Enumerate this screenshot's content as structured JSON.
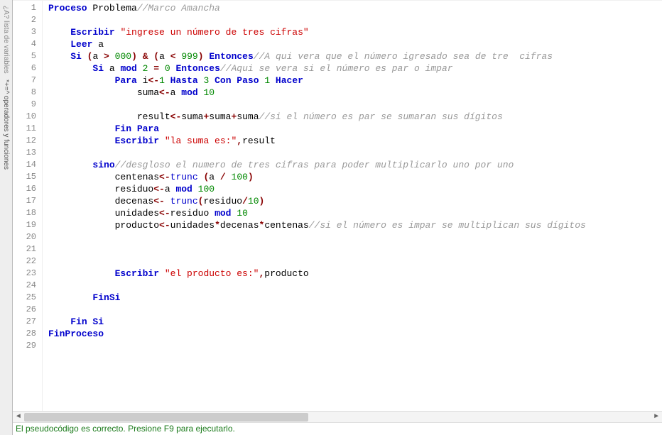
{
  "sidebar": {
    "tab1_icon": "¿A?",
    "tab1_label": " lista de variables",
    "tab2_icon": "*+=^",
    "tab2_label": " operadores y funciones"
  },
  "lines": [
    {
      "n": "1",
      "indent": 0,
      "tokens": [
        [
          "kw",
          "Proceso"
        ],
        [
          "ident",
          " Problema"
        ],
        [
          "com",
          "//Marco Amancha"
        ]
      ]
    },
    {
      "n": "2",
      "indent": 1,
      "tokens": []
    },
    {
      "n": "3",
      "indent": 1,
      "tokens": [
        [
          "kw",
          "Escribir "
        ],
        [
          "str",
          "\"ingrese un número de tres cifras\""
        ]
      ]
    },
    {
      "n": "4",
      "indent": 1,
      "tokens": [
        [
          "kw",
          "Leer"
        ],
        [
          "ident",
          " a"
        ]
      ]
    },
    {
      "n": "5",
      "indent": 1,
      "tokens": [
        [
          "kw",
          "Si "
        ],
        [
          "op",
          "("
        ],
        [
          "ident",
          "a "
        ],
        [
          "op",
          ">"
        ],
        [
          "num",
          " 000"
        ],
        [
          "op",
          ")"
        ],
        [
          "op",
          " & "
        ],
        [
          "op",
          "("
        ],
        [
          "ident",
          "a "
        ],
        [
          "op",
          "<"
        ],
        [
          "num",
          " 999"
        ],
        [
          "op",
          ")"
        ],
        [
          "kw",
          " Entonces"
        ],
        [
          "com",
          "//A qui vera que el número igresado sea de tre  cifras"
        ]
      ]
    },
    {
      "n": "6",
      "indent": 2,
      "tokens": [
        [
          "kw",
          "Si"
        ],
        [
          "ident",
          " a "
        ],
        [
          "kw",
          "mod "
        ],
        [
          "num",
          "2"
        ],
        [
          "op",
          " = "
        ],
        [
          "num",
          "0"
        ],
        [
          "kw",
          " Entonces"
        ],
        [
          "com",
          "//Aqui se vera si el número es par o impar"
        ]
      ]
    },
    {
      "n": "7",
      "indent": 3,
      "tokens": [
        [
          "kw",
          "Para"
        ],
        [
          "ident",
          " i"
        ],
        [
          "op",
          "<-"
        ],
        [
          "num",
          "1"
        ],
        [
          "kw",
          " Hasta "
        ],
        [
          "num",
          "3"
        ],
        [
          "kw",
          " Con Paso "
        ],
        [
          "num",
          "1"
        ],
        [
          "kw",
          " Hacer"
        ]
      ]
    },
    {
      "n": "8",
      "indent": 4,
      "tokens": [
        [
          "ident",
          "suma"
        ],
        [
          "op",
          "<-"
        ],
        [
          "ident",
          "a "
        ],
        [
          "kw",
          "mod "
        ],
        [
          "num",
          "10"
        ]
      ]
    },
    {
      "n": "9",
      "indent": 4,
      "tokens": []
    },
    {
      "n": "10",
      "indent": 4,
      "tokens": [
        [
          "ident",
          "result"
        ],
        [
          "op",
          "<-"
        ],
        [
          "ident",
          "suma"
        ],
        [
          "op",
          "+"
        ],
        [
          "ident",
          "suma"
        ],
        [
          "op",
          "+"
        ],
        [
          "ident",
          "suma"
        ],
        [
          "com",
          "//si el número es par se sumaran sus dígitos"
        ]
      ]
    },
    {
      "n": "11",
      "indent": 3,
      "tokens": [
        [
          "kw",
          "Fin Para"
        ]
      ]
    },
    {
      "n": "12",
      "indent": 3,
      "tokens": [
        [
          "kw",
          "Escribir "
        ],
        [
          "str",
          "\"la suma es:\""
        ],
        [
          "op",
          ","
        ],
        [
          "ident",
          "result"
        ]
      ]
    },
    {
      "n": "13",
      "indent": 3,
      "tokens": []
    },
    {
      "n": "14",
      "indent": 2,
      "tokens": [
        [
          "kw",
          "sino"
        ],
        [
          "com",
          "//desgloso el numero de tres cifras para poder multiplicarlo uno por uno"
        ]
      ]
    },
    {
      "n": "15",
      "indent": 3,
      "tokens": [
        [
          "ident",
          "centenas"
        ],
        [
          "op",
          "<-"
        ],
        [
          "func",
          "trunc"
        ],
        [
          "ident",
          " "
        ],
        [
          "op",
          "("
        ],
        [
          "ident",
          "a "
        ],
        [
          "op",
          "/"
        ],
        [
          "num",
          " 100"
        ],
        [
          "op",
          ")"
        ]
      ]
    },
    {
      "n": "16",
      "indent": 3,
      "tokens": [
        [
          "ident",
          "residuo"
        ],
        [
          "op",
          "<-"
        ],
        [
          "ident",
          "a "
        ],
        [
          "kw",
          "mod "
        ],
        [
          "num",
          "100"
        ]
      ]
    },
    {
      "n": "17",
      "indent": 3,
      "tokens": [
        [
          "ident",
          "decenas"
        ],
        [
          "op",
          "<- "
        ],
        [
          "func",
          "trunc"
        ],
        [
          "op",
          "("
        ],
        [
          "ident",
          "residuo"
        ],
        [
          "op",
          "/"
        ],
        [
          "num",
          "10"
        ],
        [
          "op",
          ")"
        ]
      ]
    },
    {
      "n": "18",
      "indent": 3,
      "tokens": [
        [
          "ident",
          "unidades"
        ],
        [
          "op",
          "<-"
        ],
        [
          "ident",
          "residuo "
        ],
        [
          "kw",
          "mod "
        ],
        [
          "num",
          "10"
        ]
      ]
    },
    {
      "n": "19",
      "indent": 3,
      "tokens": [
        [
          "ident",
          "producto"
        ],
        [
          "op",
          "<-"
        ],
        [
          "ident",
          "unidades"
        ],
        [
          "op",
          "*"
        ],
        [
          "ident",
          "decenas"
        ],
        [
          "op",
          "*"
        ],
        [
          "ident",
          "centenas"
        ],
        [
          "com",
          "//si el número es impar se multiplican sus dígitos"
        ]
      ]
    },
    {
      "n": "20",
      "indent": 3,
      "tokens": []
    },
    {
      "n": "21",
      "indent": 1,
      "tokens": []
    },
    {
      "n": "22",
      "indent": 3,
      "tokens": []
    },
    {
      "n": "23",
      "indent": 3,
      "tokens": [
        [
          "kw",
          "Escribir "
        ],
        [
          "str",
          "\"el producto es:\""
        ],
        [
          "op",
          ","
        ],
        [
          "ident",
          "producto"
        ]
      ]
    },
    {
      "n": "24",
      "indent": 3,
      "tokens": []
    },
    {
      "n": "25",
      "indent": 2,
      "tokens": [
        [
          "kw",
          "FinSi"
        ]
      ]
    },
    {
      "n": "26",
      "indent": 2,
      "tokens": []
    },
    {
      "n": "27",
      "indent": 1,
      "tokens": [
        [
          "kw",
          "Fin Si"
        ]
      ]
    },
    {
      "n": "28",
      "indent": 0,
      "tokens": [
        [
          "kw",
          "FinProceso"
        ]
      ]
    },
    {
      "n": "29",
      "indent": 0,
      "tokens": []
    }
  ],
  "status": "El pseudocódigo es correcto. Presione F9 para ejecutarlo."
}
